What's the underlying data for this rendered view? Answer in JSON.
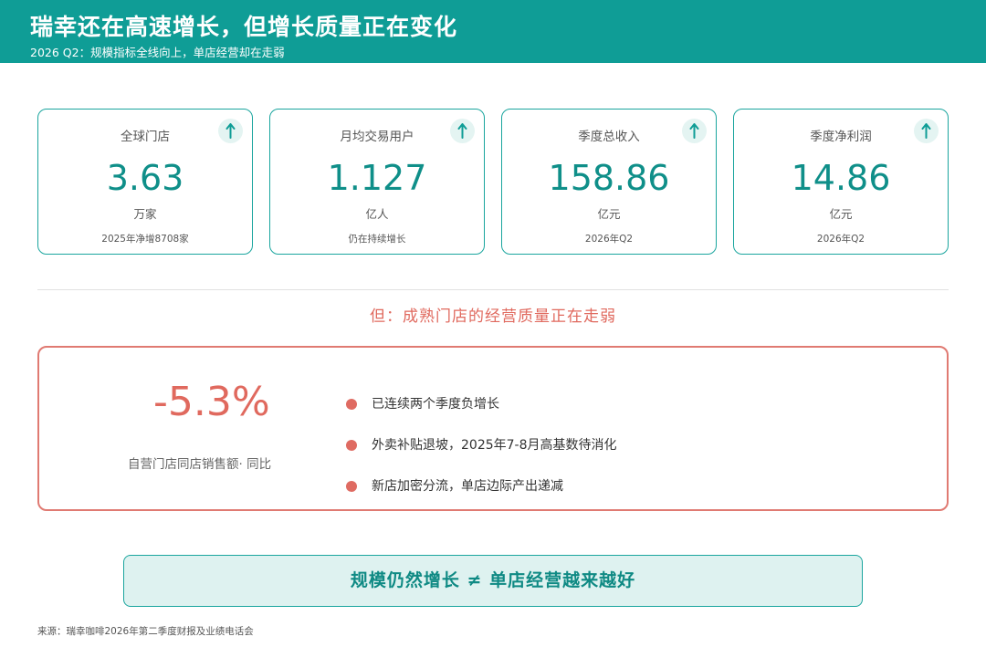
{
  "header": {
    "title": "瑞幸还在高速增长，但增长质量正在变化",
    "subtitle": "2026 Q2：规模指标全线向上，单店经营却在走弱"
  },
  "kpis": [
    {
      "label": "全球门店",
      "value": "3.63",
      "unit": "万家",
      "note": "2025年净增8708家",
      "trend_icon": "arrow-up-icon"
    },
    {
      "label": "月均交易用户",
      "value": "1.127",
      "unit": "亿人",
      "note": "仍在持续增长",
      "trend_icon": "arrow-up-icon"
    },
    {
      "label": "季度总收入",
      "value": "158.86",
      "unit": "亿元",
      "note": "2026年Q2",
      "trend_icon": "arrow-up-icon"
    },
    {
      "label": "季度净利润",
      "value": "14.86",
      "unit": "亿元",
      "note": "2026年Q2",
      "trend_icon": "arrow-up-icon"
    }
  ],
  "alert": {
    "heading": "但：成熟门店的经营质量正在走弱",
    "value": "-5.3%",
    "value_label": "自营门店同店销售额· 同比",
    "bullets": [
      "已连续两个季度负增长",
      "外卖补贴退坡，2025年7-8月高基数待消化",
      "新店加密分流，单店边际产出递减"
    ]
  },
  "conclusion": "规模仍然增长 ≠ 单店经营越来越好",
  "source": "来源：瑞幸咖啡2026年第二季度财报及业绩电话会",
  "colors": {
    "primary": "#0f9d96",
    "alert": "#e0695e",
    "conclusion_bg": "#def2f0"
  }
}
